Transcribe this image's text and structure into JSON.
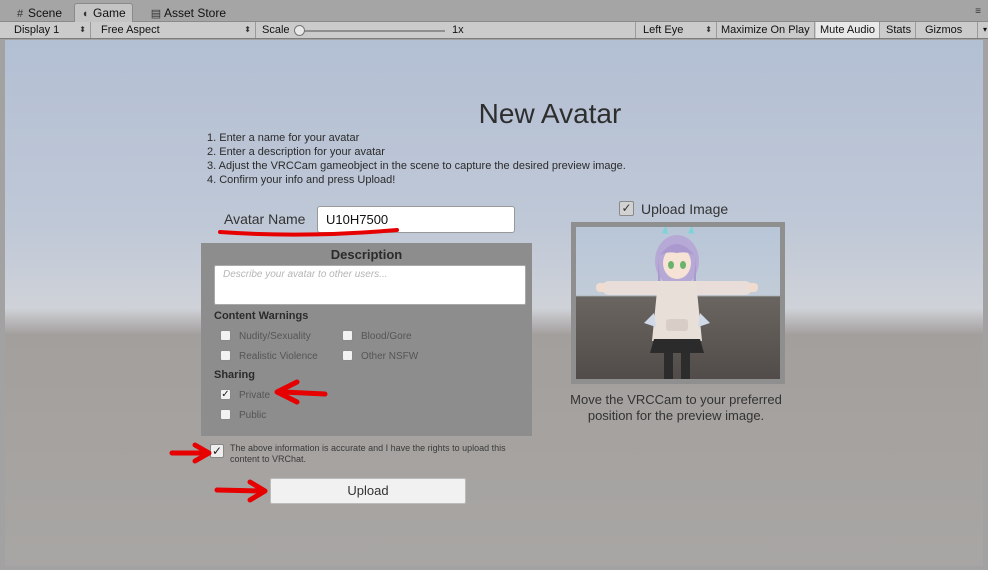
{
  "tabs": [
    {
      "label": "Scene",
      "icon": "grid-icon"
    },
    {
      "label": "Game",
      "icon": "pacman-icon"
    },
    {
      "label": "Asset Store",
      "icon": "store-icon"
    }
  ],
  "toolbar": {
    "display": "Display 1",
    "aspect": "Free Aspect",
    "scale_label": "Scale",
    "scale_value": "1x",
    "eye": "Left Eye",
    "maximize": "Maximize On Play",
    "mute": "Mute Audio",
    "stats": "Stats",
    "gizmos": "Gizmos"
  },
  "form": {
    "title": "New Avatar",
    "instructions": [
      "1. Enter a name for your avatar",
      "2. Enter a description for your avatar",
      "3. Adjust the VRCCam gameobject in the scene to capture the desired preview image.",
      "4. Confirm your info and press Upload!"
    ],
    "name_label": "Avatar Name",
    "name_value": "U10H7500",
    "description_header": "Description",
    "description_placeholder": "Describe your avatar to other users...",
    "content_warnings_header": "Content Warnings",
    "warnings": {
      "nudity": "Nudity/Sexuality",
      "blood": "Blood/Gore",
      "violence": "Realistic Violence",
      "other": "Other NSFW"
    },
    "sharing_header": "Sharing",
    "sharing": {
      "private": "Private",
      "public": "Public",
      "selected": "Private"
    },
    "agreement": "The above information is accurate and I have the rights to upload this content to VRChat.",
    "upload_label": "Upload",
    "upload_image_label": "Upload Image",
    "upload_image_checked": true,
    "preview_caption": "Move the VRCCam to your preferred position for the preview image."
  },
  "colors": {
    "annotation": "#e60000"
  }
}
